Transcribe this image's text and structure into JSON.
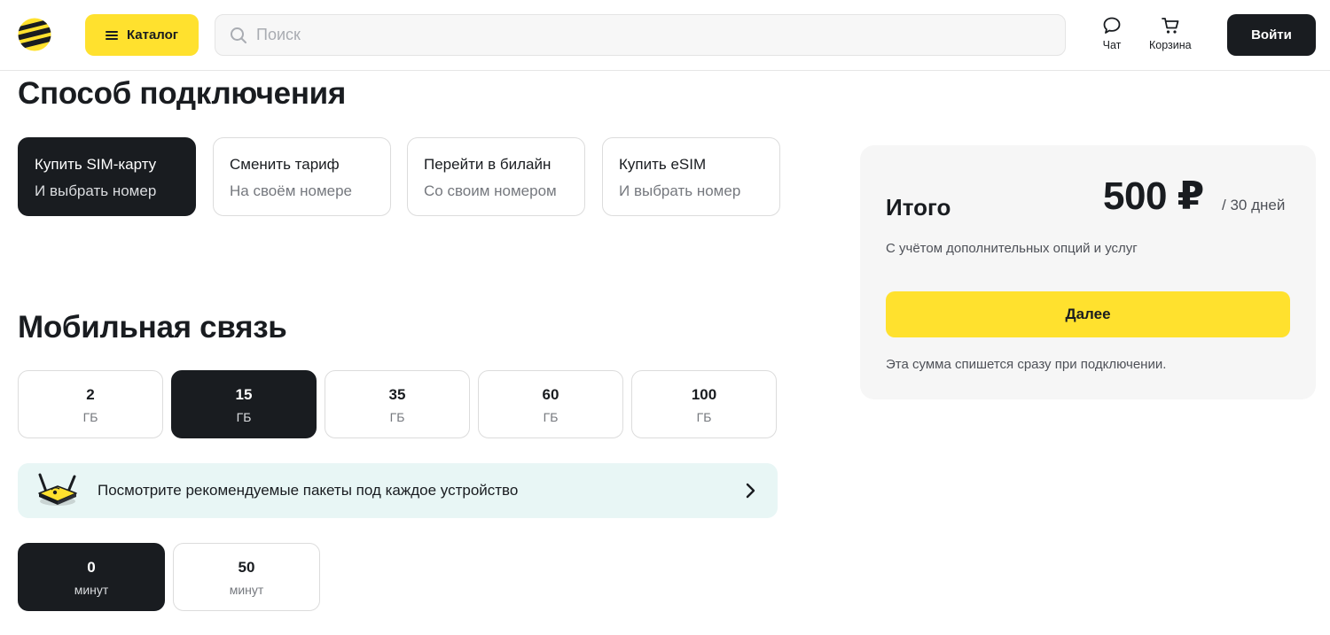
{
  "header": {
    "catalog_label": "Каталог",
    "search_placeholder": "Поиск",
    "chat_label": "Чат",
    "cart_label": "Корзина",
    "login_label": "Войти"
  },
  "connection": {
    "title": "Способ подключения",
    "options": [
      {
        "title": "Купить SIM-карту",
        "subtitle": "И выбрать номер",
        "selected": true
      },
      {
        "title": "Сменить тариф",
        "subtitle": "На своём номере",
        "selected": false
      },
      {
        "title": "Перейти в билайн",
        "subtitle": "Со своим номером",
        "selected": false
      },
      {
        "title": "Купить eSIM",
        "subtitle": "И выбрать номер",
        "selected": false
      }
    ]
  },
  "mobile": {
    "title": "Мобильная связь",
    "data_options": [
      {
        "value": "2",
        "unit": "ГБ",
        "selected": false
      },
      {
        "value": "15",
        "unit": "ГБ",
        "selected": true
      },
      {
        "value": "35",
        "unit": "ГБ",
        "selected": false
      },
      {
        "value": "60",
        "unit": "ГБ",
        "selected": false
      },
      {
        "value": "100",
        "unit": "ГБ",
        "selected": false
      }
    ],
    "banner_text": "Посмотрите рекомендуемые пакеты под каждое устройство",
    "minute_options": [
      {
        "value": "0",
        "unit": "минут",
        "selected": true
      },
      {
        "value": "50",
        "unit": "минут",
        "selected": false
      }
    ]
  },
  "summary": {
    "title": "Итого",
    "price": "500 ₽",
    "period": "/ 30 дней",
    "subtitle": "С учётом дополнительных опций и услуг",
    "button_label": "Далее",
    "note": "Эта сумма спишется сразу при подключении."
  },
  "colors": {
    "brand_yellow": "#ffe12e",
    "dark": "#191c20",
    "banner_bg": "#e8f6f5",
    "summary_bg": "#f6f6f6"
  },
  "icons": [
    "beeline-logo",
    "menu-icon",
    "search-icon",
    "chat-icon",
    "cart-icon",
    "router-icon",
    "chevron-right-icon"
  ]
}
